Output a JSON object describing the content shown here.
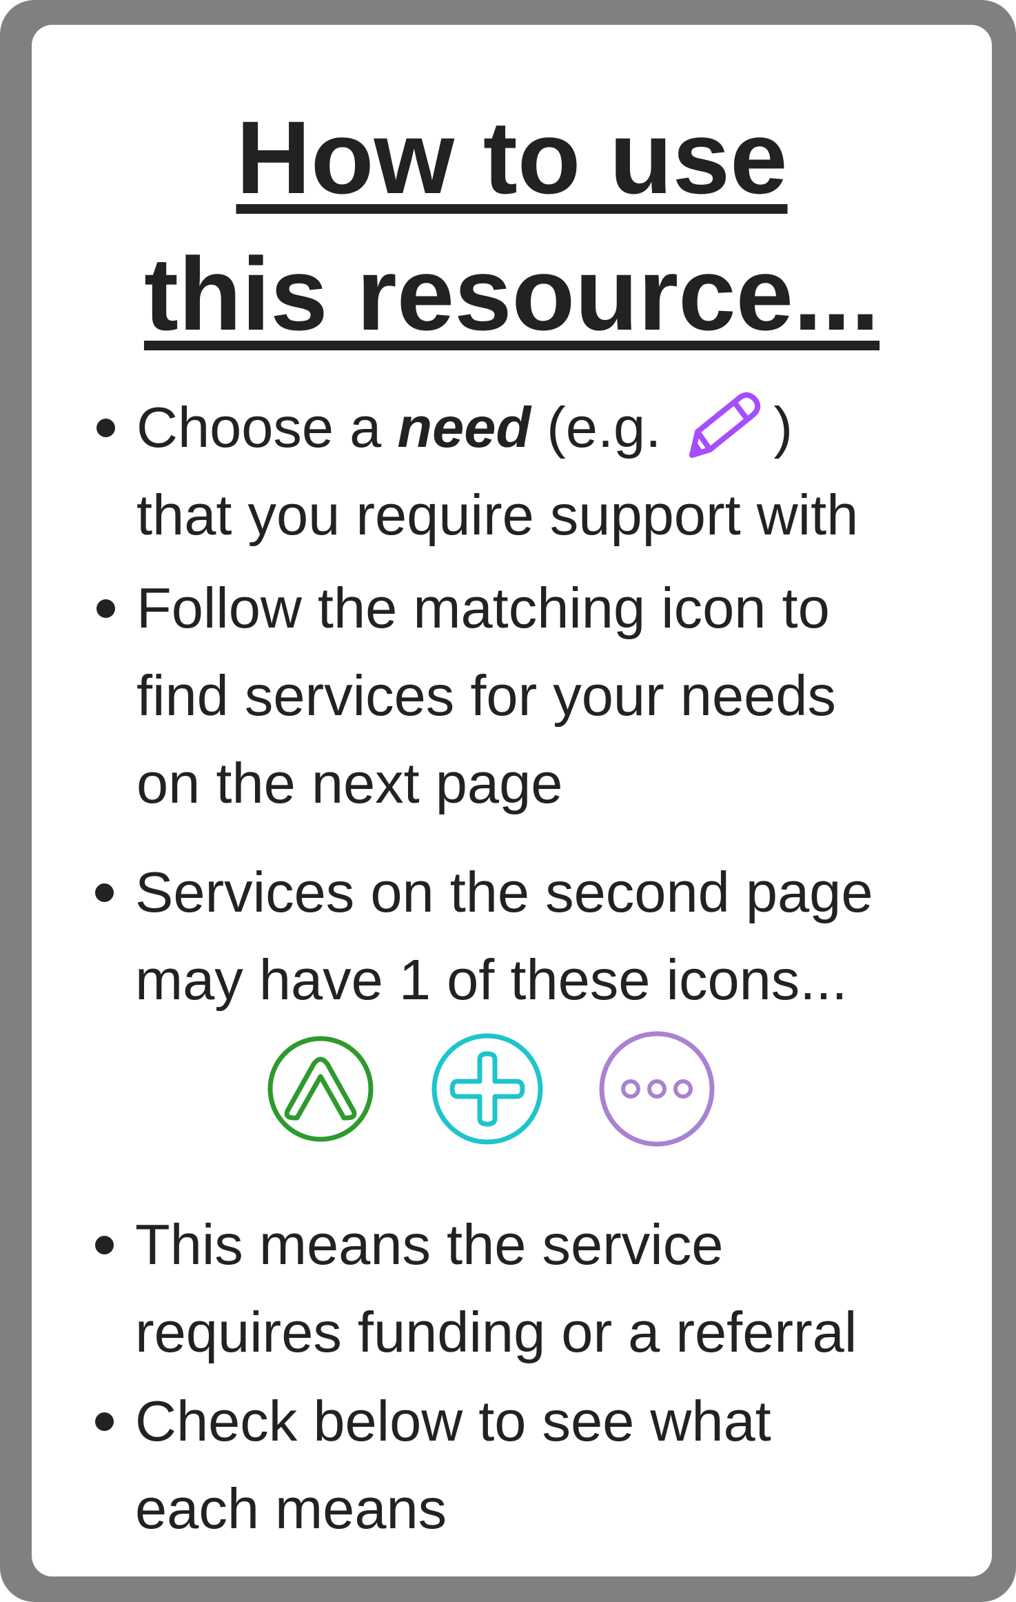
{
  "title": {
    "line1": "How to use",
    "line2": "this resource..."
  },
  "bullets": [
    {
      "line1_prefix": "Choose a ",
      "line1_bold": "need",
      "line1_middle": " (e.g. ",
      "line1_suffix": ")",
      "line2": "that you require support with"
    },
    {
      "line1": "Follow the matching icon to",
      "line2": "find services for your needs",
      "line3": "on the next page"
    },
    {
      "line1": "Services on the second page",
      "line2": "may have 1 of these icons..."
    },
    {
      "line1": "This means the service",
      "line2": "requires funding or a referral"
    },
    {
      "line1": "Check below to see what",
      "line2": "each means"
    }
  ],
  "icons": {
    "example_need": "pencil-icon",
    "legend": [
      "chevron-up-icon",
      "plus-icon",
      "more-dots-icon"
    ]
  },
  "colors": {
    "frame": "#808080",
    "text": "#222222",
    "pencil": "#a64dff",
    "chevron": "#2e9a2e",
    "plus": "#1ec4cc",
    "dots": "#a982d0"
  }
}
